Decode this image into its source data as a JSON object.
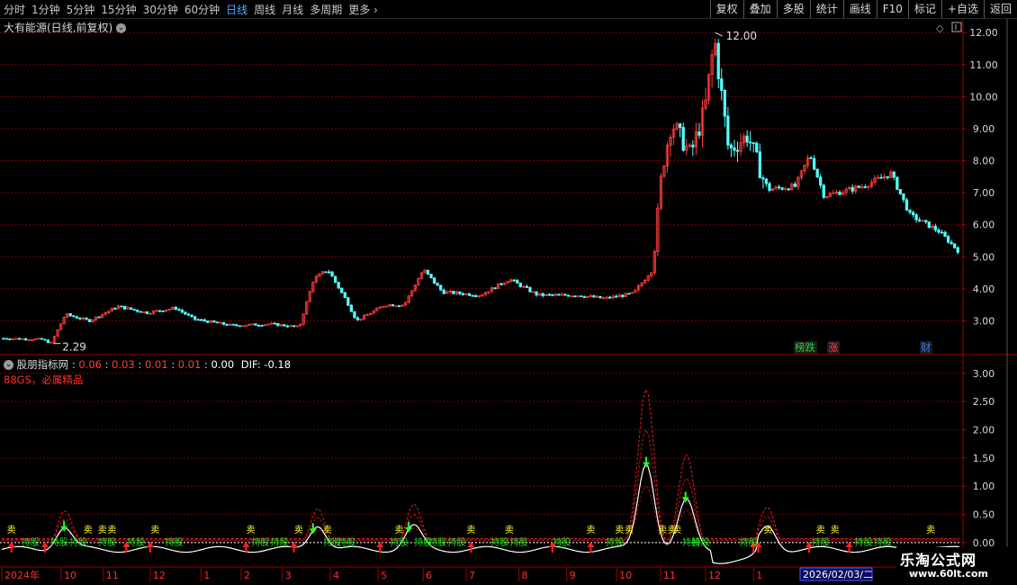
{
  "toolbar": {
    "left": [
      "分时",
      "1分钟",
      "5分钟",
      "15分钟",
      "30分钟",
      "60分钟",
      "日线",
      "周线",
      "月线",
      "多周期",
      "更多"
    ],
    "active": "日线",
    "right": [
      "复权",
      "叠加",
      "多股",
      "统计",
      "画线",
      "F10",
      "标记",
      "+自选",
      "返回"
    ]
  },
  "main_chart": {
    "title": "大有能源(日线,前复权)",
    "high_label": "12.00",
    "low_label": "2.29",
    "y_ticks": [
      "12.00",
      "11.00",
      "10.00",
      "9.00",
      "8.00",
      "7.00",
      "6.00",
      "5.00",
      "4.00",
      "3.00"
    ],
    "y_min": 2.0,
    "y_max": 12.4,
    "badges": [
      {
        "text": "榜跌",
        "color": "#2ecc40"
      },
      {
        "text": "涨",
        "color": "#ff4040"
      },
      {
        "text": "财",
        "color": "#3a7bff"
      }
    ]
  },
  "indicator": {
    "name": "股朋指标网",
    "values": [
      "0.06",
      "0.03",
      "0.01",
      "0.01",
      "0.00"
    ],
    "dif_label": "DIF: -0.18",
    "subtitle": "88GS，必属精品",
    "y_ticks": [
      "3.00",
      "2.50",
      "2.00",
      "1.50",
      "1.00",
      "0.50",
      "0.00"
    ],
    "y_min": -0.4,
    "y_max": 3.3,
    "marker_labels": {
      "buy": "买",
      "sell": "卖",
      "hold": "持股"
    }
  },
  "time_axis": {
    "labels": [
      "2024年",
      "10",
      "11",
      "12",
      "1",
      "2",
      "3",
      "4",
      "5",
      "6",
      "7",
      "8",
      "9",
      "10",
      "11",
      "12",
      "1"
    ],
    "cursor_date": "2026/02/03/二"
  },
  "watermark": {
    "text": "乐淘公式网",
    "url": "www.60lt.com"
  },
  "colors": {
    "up": "#ff3b3b",
    "down": "#54ffff",
    "grid": "#7a0000",
    "axis_text": "#d8d8d8",
    "active_tab": "#55aaff"
  },
  "chart_data": {
    "type": "candlestick",
    "price_range": [
      2.29,
      12.0
    ],
    "start_price": 2.5,
    "end_price": 5.15
  }
}
